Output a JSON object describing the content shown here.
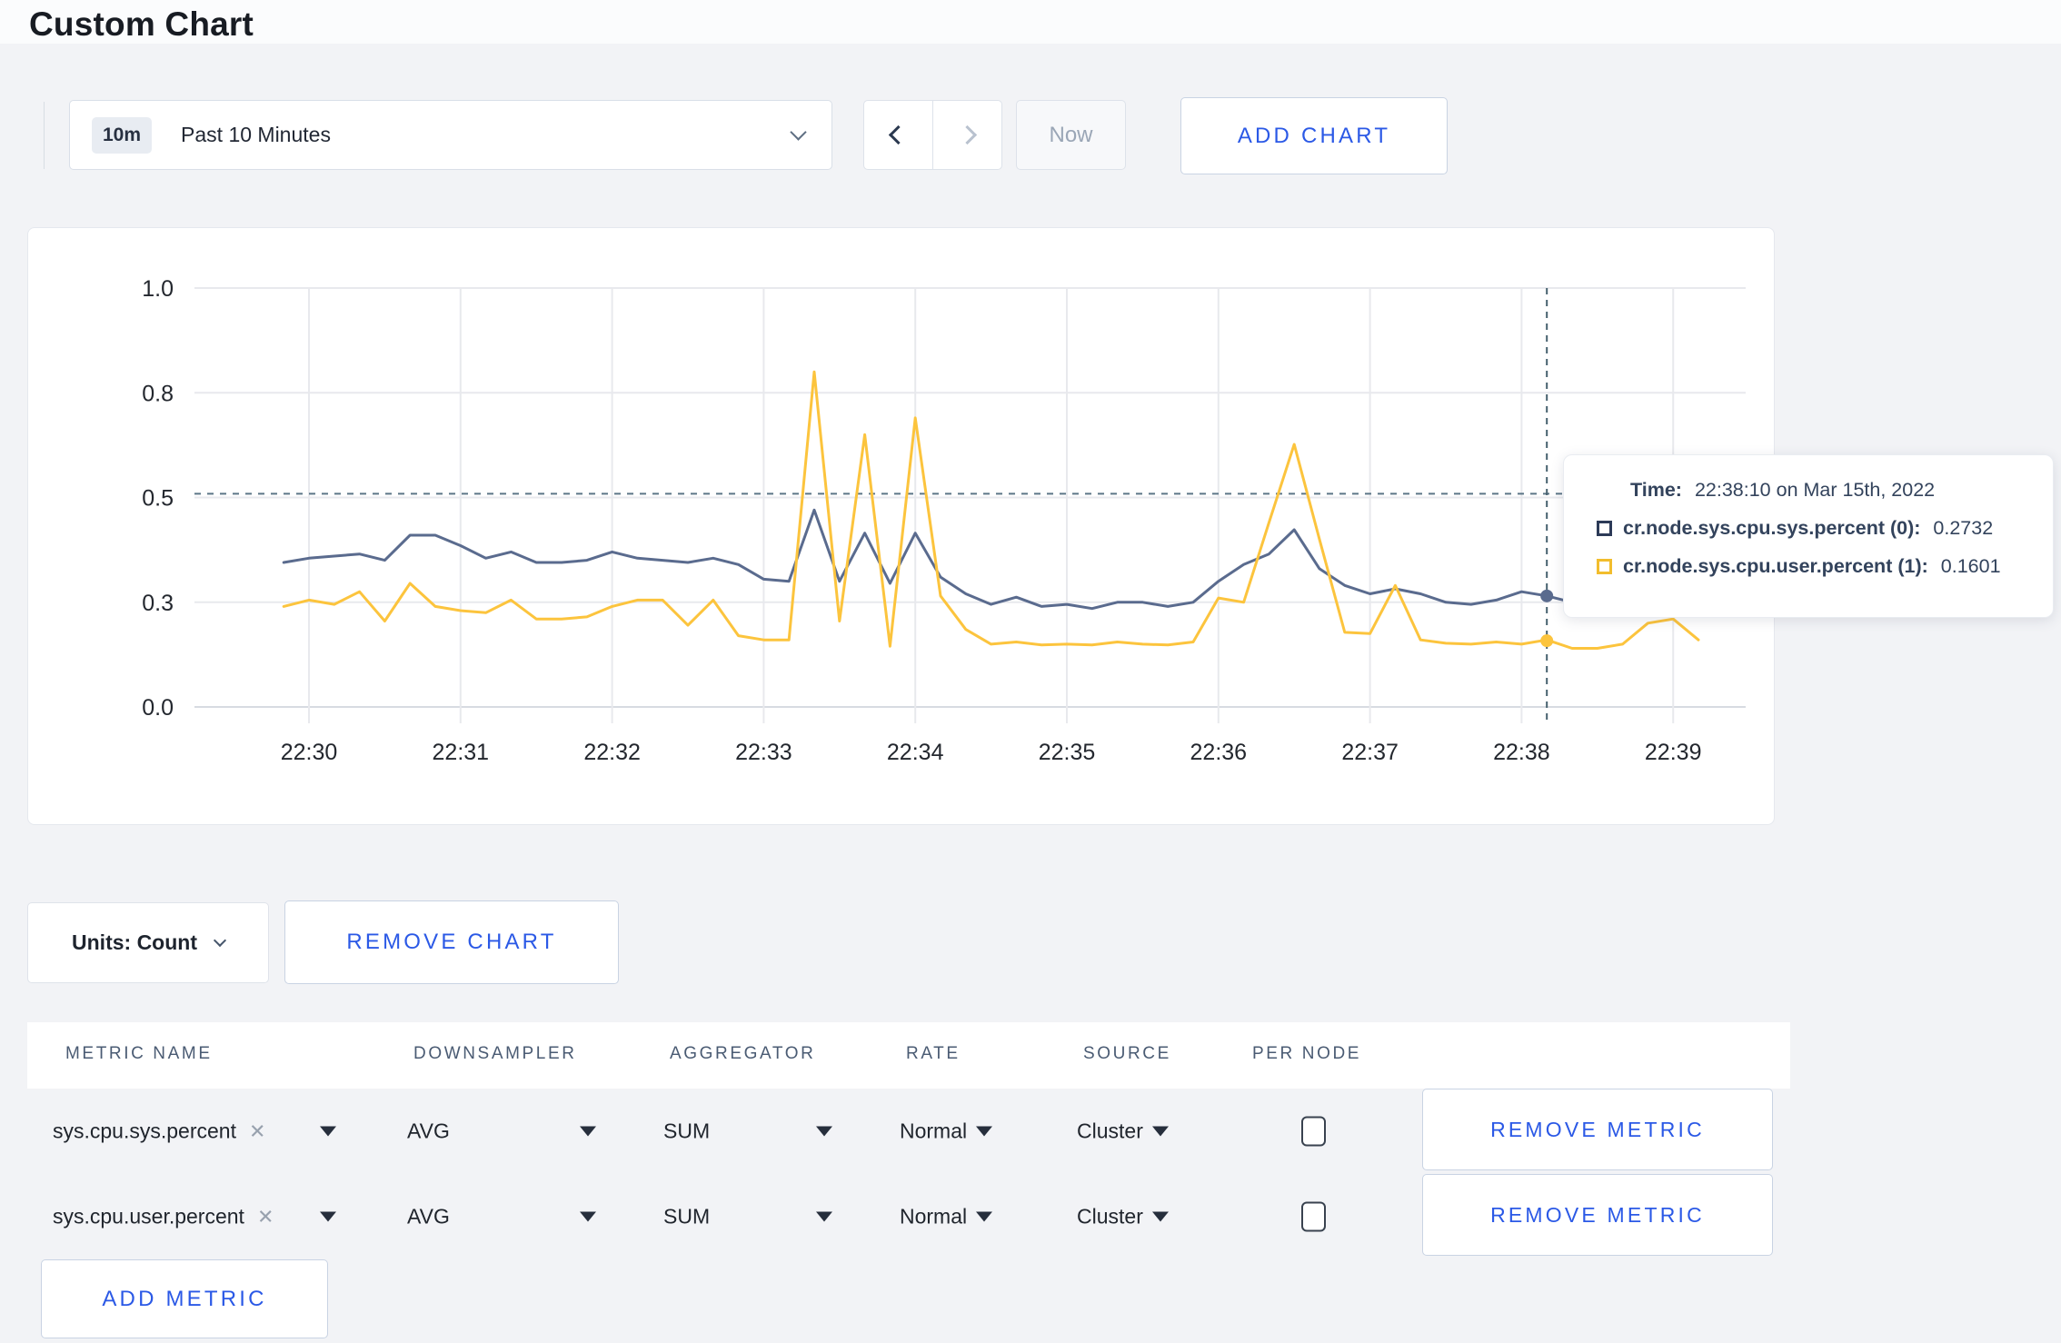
{
  "page": {
    "title": "Custom Chart"
  },
  "toolbar": {
    "time_badge": "10m",
    "time_label": "Past 10 Minutes",
    "now_label": "Now",
    "add_chart_label": "ADD CHART"
  },
  "tooltip": {
    "time_label": "Time:",
    "time_value": "22:38:10 on Mar 15th, 2022",
    "series": [
      {
        "label": "cr.node.sys.cpu.sys.percent (0):",
        "value": "0.2732",
        "color": "#2c3a57"
      },
      {
        "label": "cr.node.sys.cpu.user.percent (1):",
        "value": "0.1601",
        "color": "#f2bd2d"
      }
    ]
  },
  "units": {
    "label": "Units: Count"
  },
  "remove_chart_label": "REMOVE CHART",
  "table": {
    "headers": [
      "METRIC NAME",
      "DOWNSAMPLER",
      "AGGREGATOR",
      "RATE",
      "SOURCE",
      "PER NODE"
    ],
    "rows": [
      {
        "metric": "sys.cpu.sys.percent",
        "downsampler": "AVG",
        "aggregator": "SUM",
        "rate": "Normal",
        "source": "Cluster",
        "per_node_checked": false,
        "remove_label": "REMOVE METRIC"
      },
      {
        "metric": "sys.cpu.user.percent",
        "downsampler": "AVG",
        "aggregator": "SUM",
        "rate": "Normal",
        "source": "Cluster",
        "per_node_checked": false,
        "remove_label": "REMOVE METRIC"
      }
    ],
    "add_metric_label": "ADD METRIC"
  },
  "chart_data": {
    "type": "line",
    "title": "",
    "xlabel": "",
    "ylabel": "",
    "ylim": [
      0,
      1
    ],
    "grid": true,
    "y_ticks": [
      {
        "label": "0.0",
        "value": 0
      },
      {
        "label": "0.3",
        "value": 0.25
      },
      {
        "label": "0.5",
        "value": 0.5
      },
      {
        "label": "0.8",
        "value": 0.75
      },
      {
        "label": "1.0",
        "value": 1
      }
    ],
    "x_ticks": [
      "22:30",
      "22:31",
      "22:32",
      "22:33",
      "22:34",
      "22:35",
      "22:36",
      "22:37",
      "22:38",
      "22:39"
    ],
    "x_start_offset_seconds": -10,
    "x_step_seconds": 10,
    "series": [
      {
        "name": "cr.node.sys.cpu.sys.percent",
        "color": "#5a6b8e",
        "values": [
          0.345,
          0.355,
          0.36,
          0.365,
          0.35,
          0.41,
          0.41,
          0.385,
          0.355,
          0.37,
          0.345,
          0.345,
          0.35,
          0.37,
          0.355,
          0.35,
          0.345,
          0.355,
          0.34,
          0.305,
          0.3,
          0.47,
          0.3,
          0.415,
          0.295,
          0.415,
          0.31,
          0.27,
          0.245,
          0.262,
          0.24,
          0.245,
          0.235,
          0.25,
          0.25,
          0.24,
          0.25,
          0.3,
          0.34,
          0.365,
          0.423,
          0.33,
          0.29,
          0.27,
          0.282,
          0.27,
          0.25,
          0.245,
          0.255,
          0.275,
          0.265,
          0.25,
          0.245,
          0.25,
          0.25,
          0.245,
          0.25
        ]
      },
      {
        "name": "cr.node.sys.cpu.user.percent",
        "color": "#fcc43d",
        "values": [
          0.24,
          0.255,
          0.245,
          0.275,
          0.205,
          0.295,
          0.24,
          0.23,
          0.225,
          0.255,
          0.21,
          0.21,
          0.215,
          0.24,
          0.255,
          0.255,
          0.195,
          0.255,
          0.17,
          0.16,
          0.16,
          0.8,
          0.205,
          0.65,
          0.145,
          0.69,
          0.265,
          0.185,
          0.15,
          0.155,
          0.148,
          0.15,
          0.148,
          0.155,
          0.15,
          0.148,
          0.155,
          0.26,
          0.25,
          0.44,
          0.627,
          0.4,
          0.178,
          0.175,
          0.29,
          0.16,
          0.152,
          0.15,
          0.155,
          0.15,
          0.16,
          0.14,
          0.14,
          0.15,
          0.2,
          0.21,
          0.16
        ]
      }
    ],
    "hover": {
      "time_offset_seconds": 490,
      "h_line_value": 0.509,
      "dots": [
        {
          "series": 0,
          "value": 0.265
        },
        {
          "series": 1,
          "value": 0.158
        }
      ]
    },
    "legend_position": "tooltip"
  }
}
